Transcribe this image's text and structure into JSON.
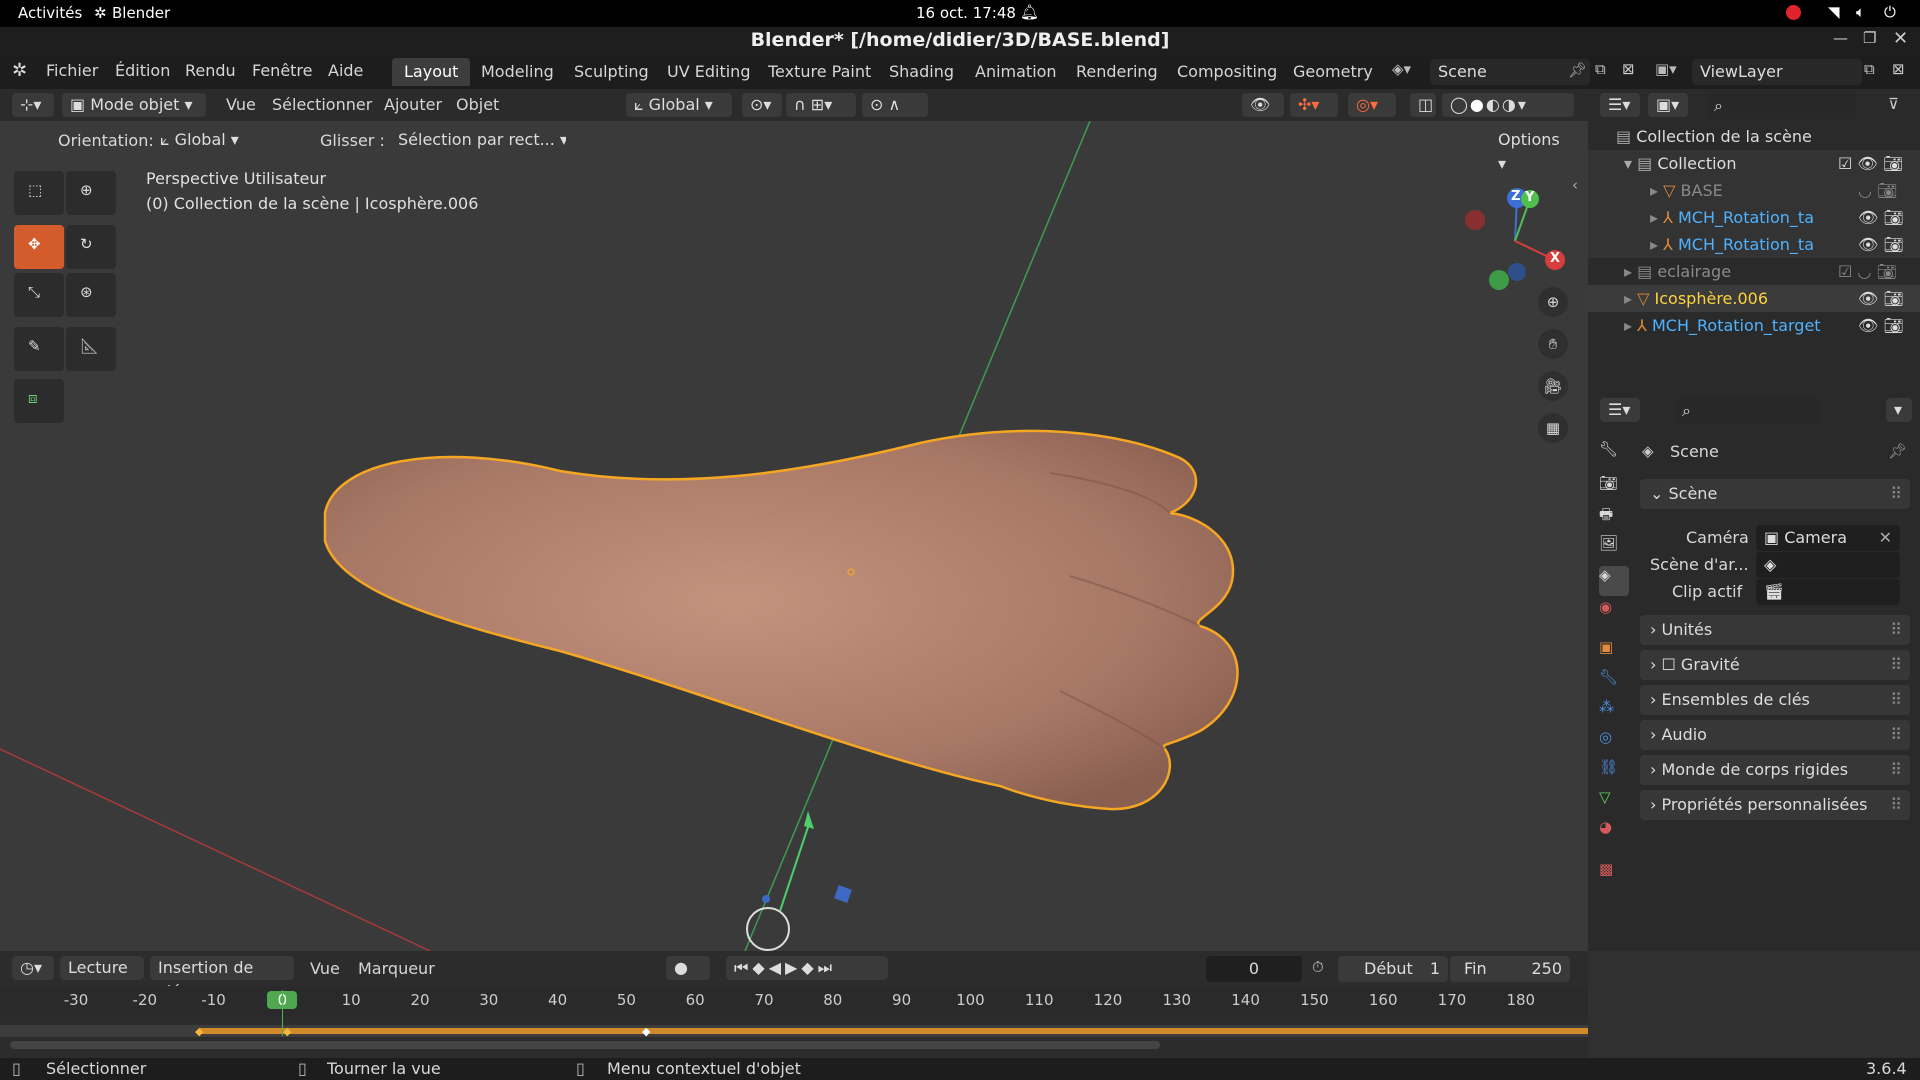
{
  "system": {
    "activities": "Activités",
    "app": "Blender",
    "clock": "16 oct.  17:48"
  },
  "window": {
    "title": "Blender* [/home/didier/3D/BASE.blend]"
  },
  "menus": [
    "Fichier",
    "Édition",
    "Rendu",
    "Fenêtre",
    "Aide"
  ],
  "workspaces": [
    "Layout",
    "Modeling",
    "Sculpting",
    "UV Editing",
    "Texture Paint",
    "Shading",
    "Animation",
    "Rendering",
    "Compositing",
    "Geometry N"
  ],
  "scene_field": "Scene",
  "viewlayer_field": "ViewLayer",
  "viewport_header": {
    "mode": "Mode objet",
    "menu_view": "Vue",
    "menu_select": "Sélectionner",
    "menu_add": "Ajouter",
    "menu_object": "Objet",
    "transform": "Global"
  },
  "tool_settings": {
    "orientation_label": "Orientation:",
    "orientation_value": "Global",
    "drag_label": "Glisser :",
    "drag_value": "Sélection par rect...",
    "options": "Options"
  },
  "overlay_text": {
    "line1": "Perspective Utilisateur",
    "line2": "(0) Collection de la scène | Icosphère.006"
  },
  "gizmo": {
    "z": "Z",
    "y": "Y",
    "x": "X"
  },
  "outliner": {
    "root": "Collection de la scène",
    "rows": [
      {
        "label": "Collection",
        "color": "#dcdcdc",
        "indent": 1
      },
      {
        "label": "BASE",
        "color": "#8a8a8a",
        "indent": 2
      },
      {
        "label": "MCH_Rotation_ta",
        "color": "#4fb2ff",
        "indent": 2
      },
      {
        "label": "MCH_Rotation_ta",
        "color": "#4fb2ff",
        "indent": 2
      },
      {
        "label": "eclairage",
        "color": "#8a8a8a",
        "indent": 1
      },
      {
        "label": "Icosphère.006",
        "color": "#ffd23f",
        "indent": 1
      },
      {
        "label": "MCH_Rotation_target",
        "color": "#4fb2ff",
        "indent": 1
      }
    ]
  },
  "properties": {
    "context": "Scene",
    "panel_scene": "Scène",
    "camera_label": "Caméra",
    "camera_value": "Camera",
    "background_label": "Scène d'ar...",
    "clip_label": "Clip actif",
    "panels": [
      "Unités",
      "Gravité",
      "Ensembles de clés",
      "Audio",
      "Monde de corps rigides",
      "Propriétés personnalisées"
    ]
  },
  "timeline": {
    "playback": "Lecture",
    "keying": "Insertion de clés",
    "view": "Vue",
    "marker": "Marqueur",
    "current_frame": "0",
    "start_label": "Début",
    "start_value": "1",
    "end_label": "Fin",
    "end_value": "250",
    "ruler": [
      "-30",
      "-20",
      "-10",
      "0",
      "10",
      "20",
      "30",
      "40",
      "50",
      "60",
      "70",
      "80",
      "90",
      "100",
      "110",
      "120",
      "130",
      "140",
      "150",
      "160",
      "170",
      "180"
    ]
  },
  "status": {
    "select": "Sélectionner",
    "rotate": "Tourner la vue",
    "context": "Menu contextuel d'objet",
    "version": "3.6.4"
  }
}
